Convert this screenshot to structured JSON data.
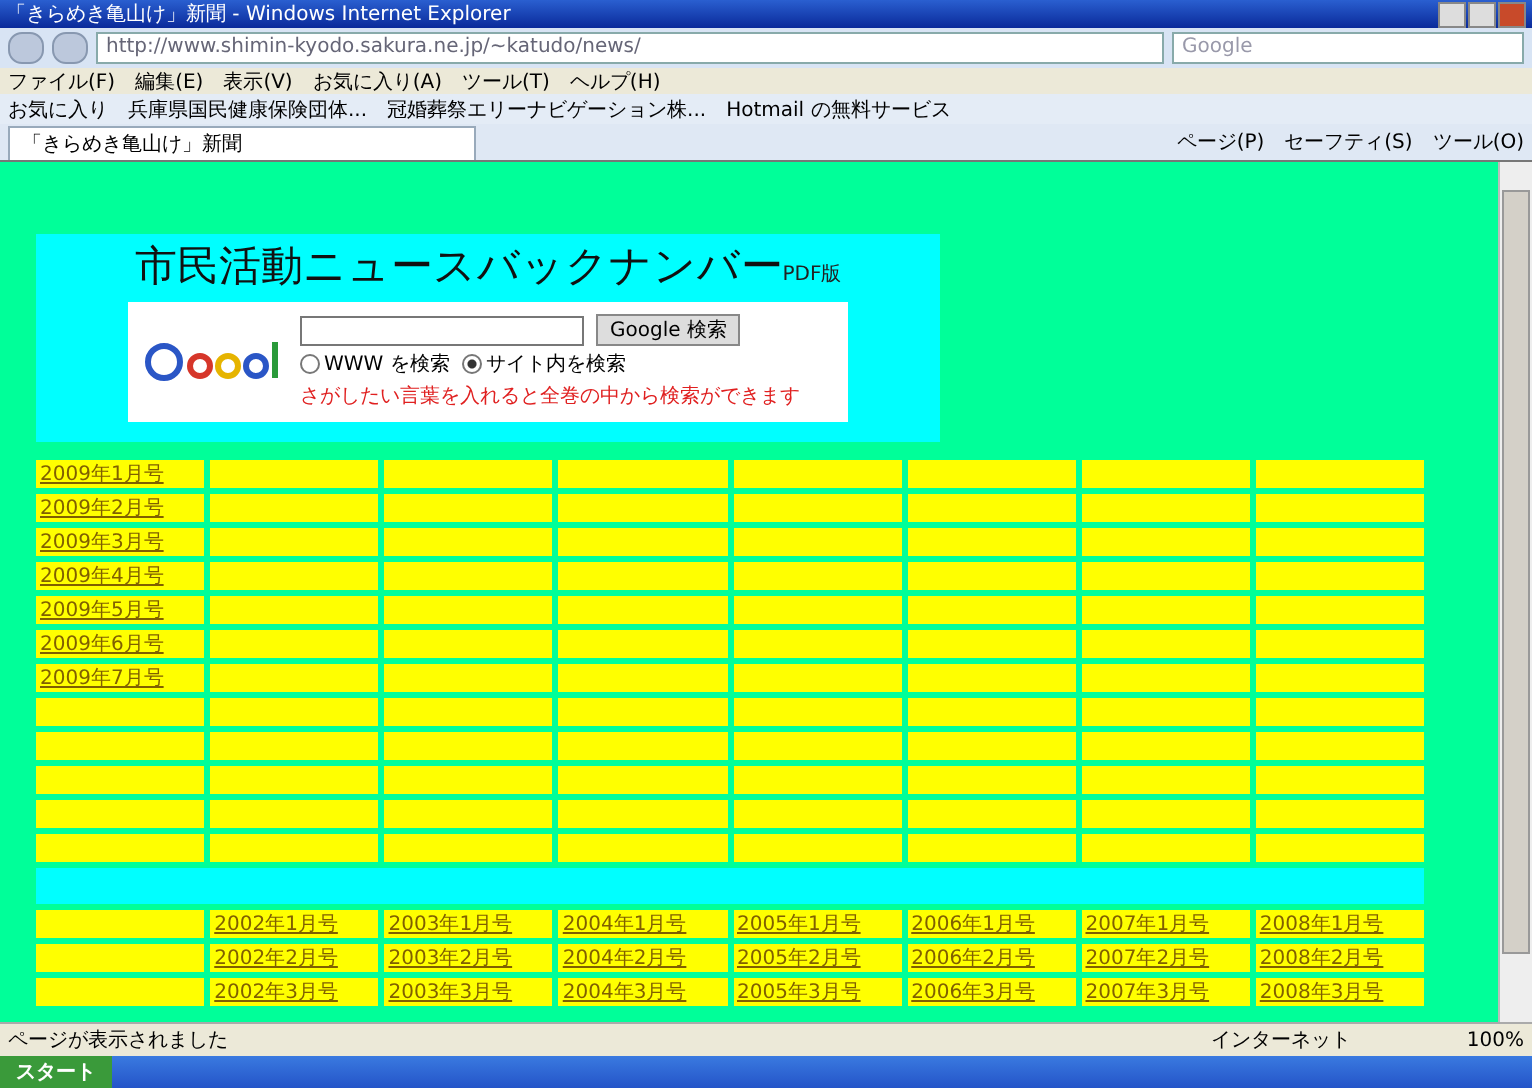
{
  "window": {
    "title": "「きらめき亀山け」新聞 - Windows Internet Explorer"
  },
  "address_bar": {
    "url": "http://www.shimin-kyodo.sakura.ne.jp/~katudo/news/",
    "search_placeholder": "Google"
  },
  "menu": [
    "ファイル(F)",
    "編集(E)",
    "表示(V)",
    "お気に入り(A)",
    "ツール(T)",
    "ヘルプ(H)"
  ],
  "favorites": [
    "お気に入り",
    "兵庫県国民健康保険団体...",
    "冠婚葬祭エリーナビゲーション株...",
    "Hotmail の無料サービス"
  ],
  "tab": {
    "title": "「きらめき亀山け」新聞"
  },
  "command_bar": [
    "ページ(P)",
    "セーフティ(S)",
    "ツール(O)"
  ],
  "page": {
    "heading": "市民活動ニュースバックナンバー",
    "heading_suffix": "PDF版",
    "search": {
      "button": "Google 検索",
      "options": [
        {
          "label": "WWW を検索",
          "selected": false
        },
        {
          "label": "サイト内を検索",
          "selected": true
        }
      ],
      "hint": "さがしたい言葉を入れると全巻の中から検索ができます"
    },
    "recent_rows": [
      {
        "issue": "2009年1月号"
      },
      {
        "issue": "2009年2月号"
      },
      {
        "issue": "2009年3月号"
      },
      {
        "issue": "2009年4月号"
      },
      {
        "issue": "2009年5月号"
      },
      {
        "issue": "2009年6月号"
      },
      {
        "issue": "2009年7月号"
      }
    ],
    "blank_rows": [
      {},
      {},
      {},
      {},
      {}
    ],
    "archive_rows": [
      {
        "issues": [
          "2002年1月号",
          "2003年1月号",
          "2004年1月号",
          "2005年1月号",
          "2006年1月号",
          "2007年1月号",
          "2008年1月号"
        ]
      },
      {
        "issues": [
          "2002年2月号",
          "2003年2月号",
          "2004年2月号",
          "2005年2月号",
          "2006年2月号",
          "2007年2月号",
          "2008年2月号"
        ]
      },
      {
        "issues": [
          "2002年3月号",
          "2003年3月号",
          "2004年3月号",
          "2005年3月号",
          "2006年3月号",
          "2007年3月号",
          "2008年3月号"
        ]
      }
    ]
  },
  "status_bar": {
    "text": "ページが表示されました",
    "zone": "インターネット",
    "zoom": "100%"
  },
  "taskbar": {
    "start": "スタート"
  }
}
